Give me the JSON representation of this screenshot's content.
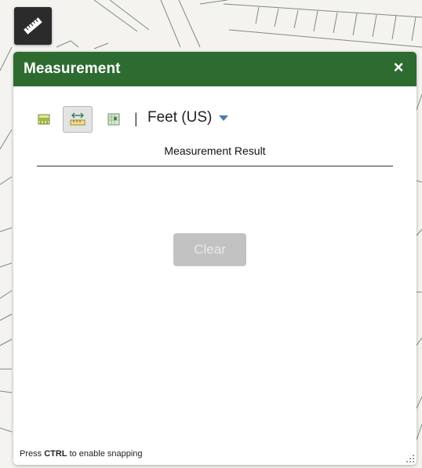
{
  "panel": {
    "title": "Measurement",
    "close_glyph": "×",
    "header_color": "#2e6b31"
  },
  "toolbar": {
    "tools": [
      {
        "name": "area",
        "icon": "area-measure-icon",
        "active": false
      },
      {
        "name": "distance",
        "icon": "distance-measure-icon",
        "active": true
      },
      {
        "name": "location",
        "icon": "location-measure-icon",
        "active": false
      }
    ],
    "separator": "|",
    "unit": "Feet (US)"
  },
  "result": {
    "heading": "Measurement Result"
  },
  "clear_label": "Clear",
  "footer": {
    "prefix": "Press ",
    "key": "CTRL",
    "suffix": " to enable snapping"
  }
}
